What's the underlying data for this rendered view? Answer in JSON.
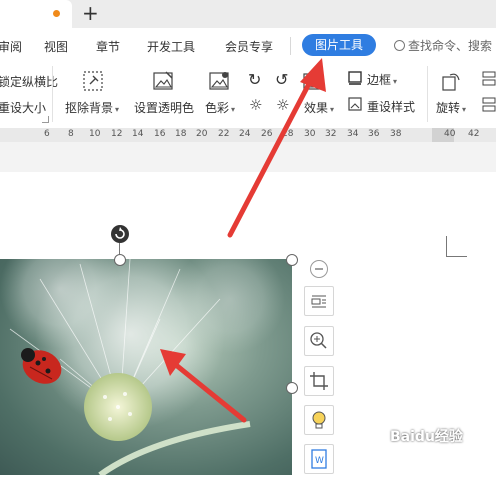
{
  "tabs": {
    "add_label": "+"
  },
  "menu": {
    "items": [
      "审阅",
      "视图",
      "章节",
      "开发工具",
      "会员专享"
    ],
    "active": "图片工具",
    "search_placeholder": "查找命令、搜索"
  },
  "ribbon": {
    "left_row1": "锁定纵横比",
    "left_row2": "重设大小",
    "remove_bg": "抠除背景",
    "set_transparent": "设置透明色",
    "color": "色彩",
    "effect": "效果",
    "border": "边框",
    "reset_style": "重设样式",
    "rotate": "旋转"
  },
  "ruler": {
    "ticks": [
      "6",
      "8",
      "10",
      "12",
      "14",
      "16",
      "18",
      "20",
      "22",
      "24",
      "26",
      "28",
      "30",
      "32",
      "34",
      "36",
      "38",
      "40",
      "42"
    ]
  },
  "watermark": "Baidu经验",
  "colors": {
    "accent": "#2f7de1",
    "arrow": "#e53b35",
    "tab_dot": "#f08a1a"
  }
}
